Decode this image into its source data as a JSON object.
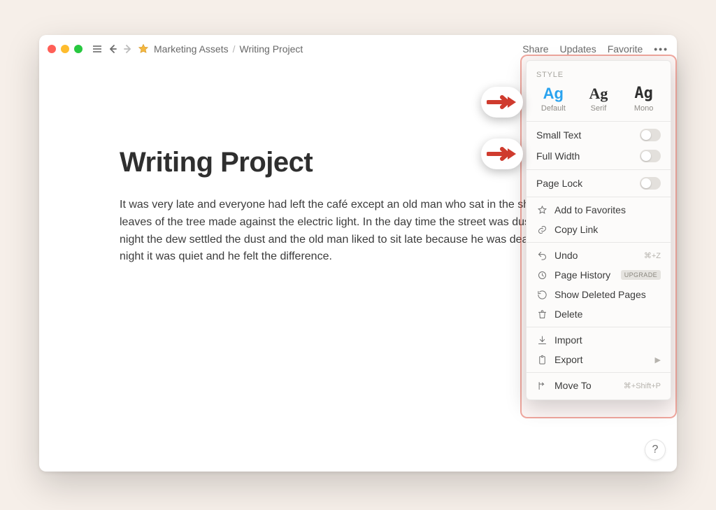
{
  "breadcrumb": {
    "parent": "Marketing Assets",
    "sep": "/",
    "current": "Writing Project"
  },
  "top_actions": {
    "share": "Share",
    "updates": "Updates",
    "favorite": "Favorite"
  },
  "page": {
    "title": "Writing Project",
    "body": "It was very late and everyone had left the café except an old man who sat in the shadow the leaves of the tree made against the electric light. In the day time the street was dusty, but at night the dew settled the dust and the old man liked to sit late because he was deaf and now at night it was quiet and he felt the difference."
  },
  "panel": {
    "style_heading": "STYLE",
    "style_opts": {
      "default": "Default",
      "serif": "Serif",
      "mono": "Mono",
      "ag": "Ag"
    },
    "small_text": "Small Text",
    "full_width": "Full Width",
    "page_lock": "Page Lock",
    "add_fav": "Add to Favorites",
    "copy_link": "Copy Link",
    "undo": "Undo",
    "undo_key": "⌘+Z",
    "history": "Page History",
    "history_badge": "UPGRADE",
    "show_deleted": "Show Deleted Pages",
    "delete": "Delete",
    "import": "Import",
    "export": "Export",
    "move_to": "Move To",
    "move_key": "⌘+Shift+P"
  },
  "help": "?"
}
